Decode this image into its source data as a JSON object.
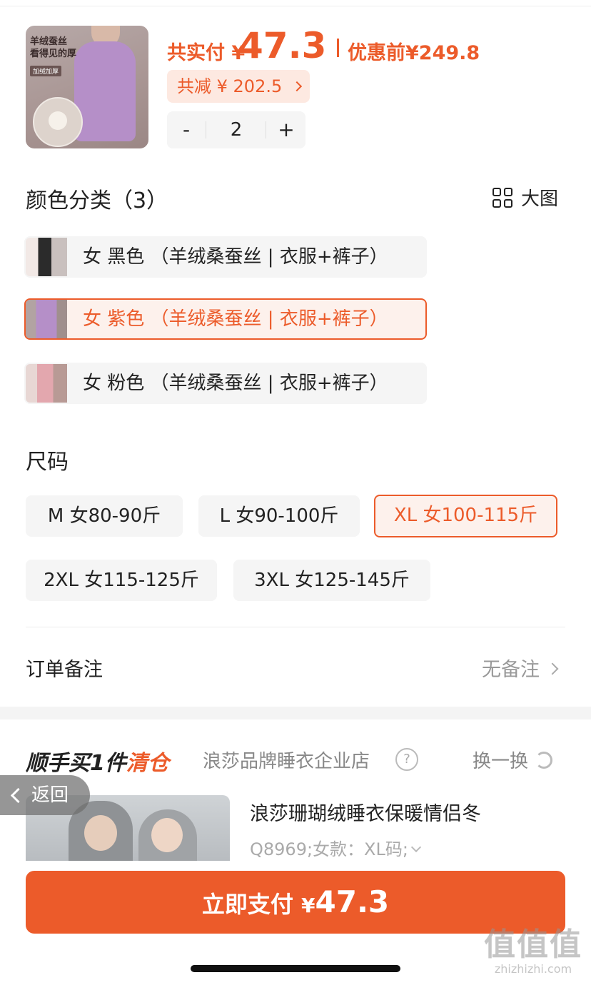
{
  "product": {
    "image_text_line1": "羊绒蚕丝",
    "image_text_line2": "看得见的厚",
    "image_tag": "加绒加厚"
  },
  "price": {
    "total_label": "共实付",
    "currency": "¥",
    "total_amount": "47.3",
    "before_label": "优惠前",
    "before_amount": "¥249.8",
    "discount_text": "共减 ¥ 202.5",
    "quantity": "2",
    "minus_label": "-",
    "plus_label": "+"
  },
  "color_section": {
    "title": "颜色分类（3）",
    "big_image_label": "大图",
    "options": [
      {
        "label": "女 黑色 （羊绒桑蚕丝 | 衣服+裤子）",
        "selected": false,
        "swatch": "#2b2b2b"
      },
      {
        "label": "女 紫色 （羊绒桑蚕丝 | 衣服+裤子）",
        "selected": true,
        "swatch": "#b58fc8"
      },
      {
        "label": "女 粉色 （羊绒桑蚕丝 | 衣服+裤子）",
        "selected": false,
        "swatch": "#e3a7ae"
      }
    ]
  },
  "size_section": {
    "title": "尺码",
    "options": [
      {
        "label": "M 女80-90斤",
        "selected": false
      },
      {
        "label": "L 女90-100斤",
        "selected": false
      },
      {
        "label": "XL 女100-115斤",
        "selected": true
      },
      {
        "label": "2XL 女115-125斤",
        "selected": false
      },
      {
        "label": "3XL 女125-145斤",
        "selected": false
      }
    ]
  },
  "order_note": {
    "label": "订单备注",
    "value": "无备注"
  },
  "addon": {
    "title_prefix": "顺手买1件",
    "title_suffix": "清仓",
    "store": "浪莎品牌睡衣企业店",
    "help_icon": "question-icon",
    "swap_label": "换一换",
    "product_name": "浪莎珊瑚绒睡衣保暖情侣冬",
    "product_spec": "Q8969;女款：XL码;"
  },
  "back": {
    "label": "返回"
  },
  "pay_button": {
    "label": "立即支付",
    "currency": "¥",
    "amount": "47.3"
  },
  "watermark": {
    "big": "值值值",
    "small": "zhizhizhi.com"
  },
  "colors": {
    "accent": "#ec5b2a",
    "accent_bg": "#fdf1ec",
    "option_bg": "#f5f5f5"
  }
}
